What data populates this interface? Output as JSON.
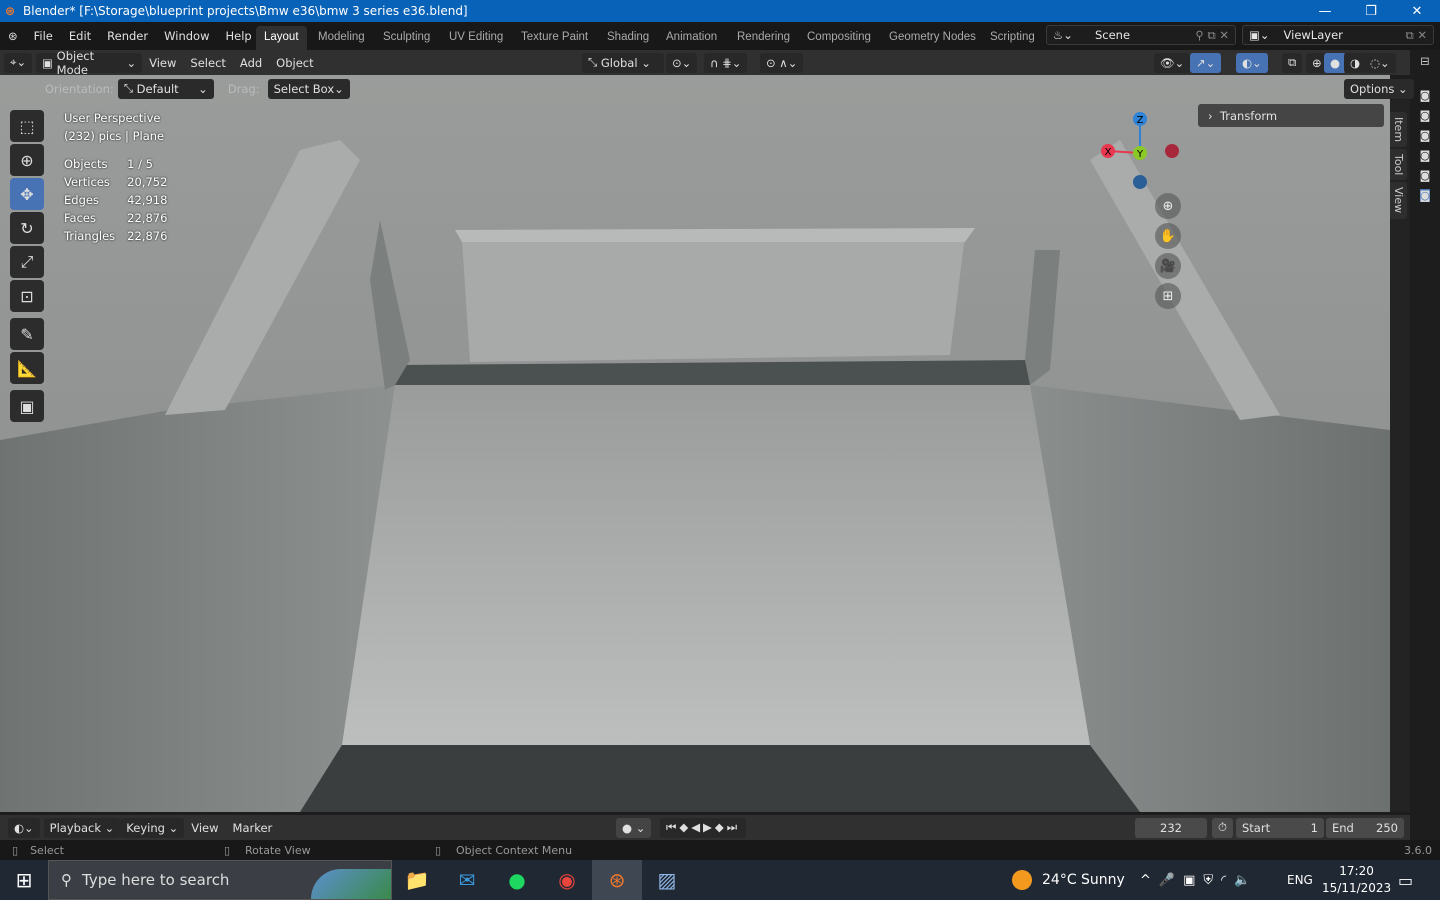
{
  "window": {
    "title": "Blender* [F:\\Storage\\blueprint projects\\Bmw e36\\bmw 3 series e36.blend]",
    "minimize": "—",
    "restore": "❐",
    "close": "✕"
  },
  "menu": [
    "File",
    "Edit",
    "Render",
    "Window",
    "Help"
  ],
  "workspaces": [
    "Layout",
    "Modeling",
    "Sculpting",
    "UV Editing",
    "Texture Paint",
    "Shading",
    "Animation",
    "Rendering",
    "Compositing",
    "Geometry Nodes",
    "Scripting"
  ],
  "active_workspace": "Layout",
  "scene": "Scene",
  "view_layer": "ViewLayer",
  "header": {
    "mode": "Object Mode",
    "menus": [
      "View",
      "Select",
      "Add",
      "Object"
    ],
    "orientation": "Global"
  },
  "tool_settings": {
    "orientation_label": "Orientation:",
    "orientation_value": "Default",
    "drag_label": "Drag:",
    "drag_value": "Select Box",
    "options": "Options"
  },
  "overlay": {
    "view_name": "User Perspective",
    "object": "(232) pics | Plane",
    "stats": [
      {
        "label": "Objects",
        "value": "1 / 5"
      },
      {
        "label": "Vertices",
        "value": "20,752"
      },
      {
        "label": "Edges",
        "value": "42,918"
      },
      {
        "label": "Faces",
        "value": "22,876"
      },
      {
        "label": "Triangles",
        "value": "22,876"
      }
    ]
  },
  "sidebar": {
    "panel": "Transform",
    "tabs": [
      "Item",
      "Tool",
      "View"
    ]
  },
  "gizmo": {
    "x": "X",
    "y": "Y",
    "z": "Z",
    "colors": {
      "x": "#e8384f",
      "y": "#8ac926",
      "z": "#2f83d6"
    }
  },
  "timeline": {
    "menus": [
      "Playback",
      "Keying",
      "View",
      "Marker"
    ],
    "current_frame": "232",
    "start_label": "Start",
    "start": "1",
    "end_label": "End",
    "end": "250"
  },
  "status": {
    "left": "Select",
    "middle": "Rotate View",
    "right": "Object Context Menu",
    "version": "3.6.0"
  },
  "taskbar": {
    "search_placeholder": "Type here to search",
    "weather": "24°C  Sunny",
    "lang": "ENG",
    "time": "17:20",
    "date": "15/11/2023"
  },
  "colors": {
    "accent": "#4772b3",
    "titlebar": "#0862b8"
  }
}
